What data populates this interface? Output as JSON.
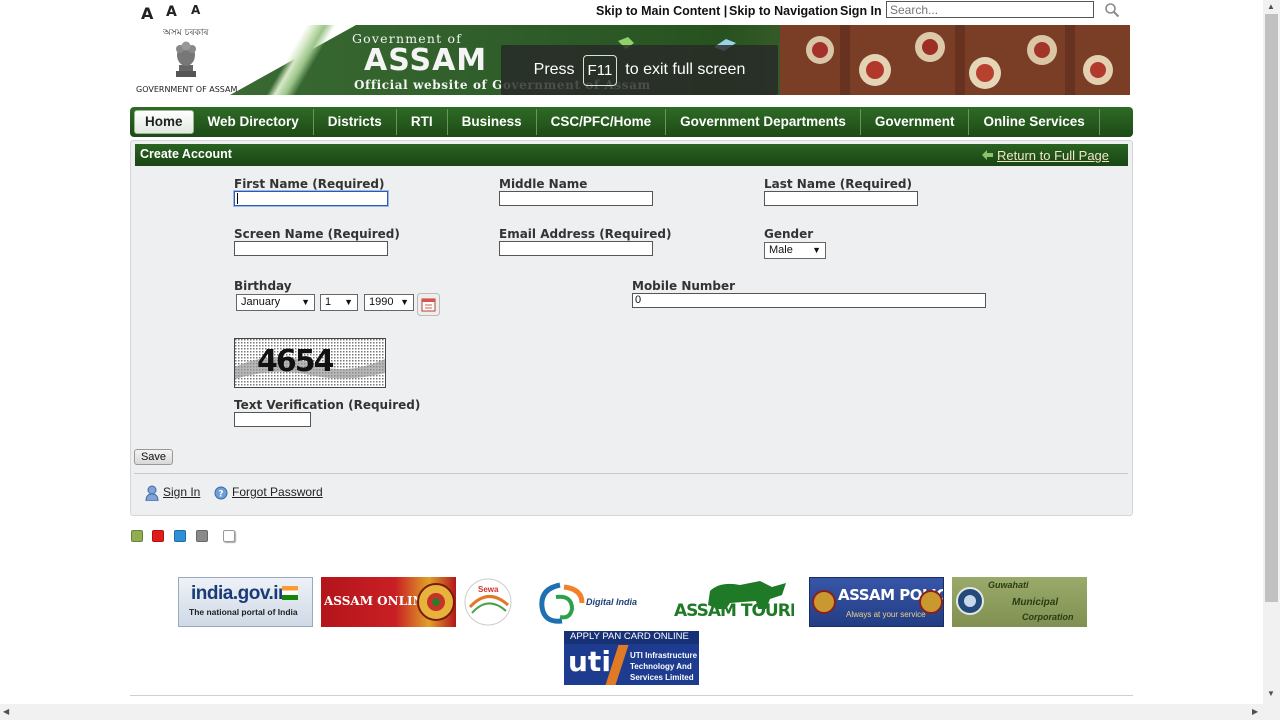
{
  "font_size_controls": [
    "A",
    "A",
    "A"
  ],
  "top_links": {
    "skip_main": "Skip to Main Content |",
    "skip_nav": "Skip to Navigation",
    "sign_in": "Sign In"
  },
  "search": {
    "placeholder": "Search..."
  },
  "banner": {
    "emblem_text": "অসম চৰকাৰ",
    "emblem_caption": "GOVERNMENT OF ASSAM",
    "gov_of": "Government of",
    "state": "ASSAM",
    "official": "Official website of  Government of Assam"
  },
  "fullscreen_notice": {
    "press": "Press",
    "key": "F11",
    "rest": "to exit full screen"
  },
  "nav": {
    "items": [
      "Home",
      "Web Directory",
      "Districts",
      "RTI",
      "Business",
      "CSC/PFC/Home",
      "Government Departments",
      "Government",
      "Online Services"
    ],
    "active": "Home"
  },
  "panel": {
    "title": "Create Account",
    "return_link": "Return to Full Page"
  },
  "form": {
    "first_name_label": "First Name (Required)",
    "first_name_value": "",
    "middle_name_label": "Middle Name",
    "middle_name_value": "",
    "last_name_label": "Last Name (Required)",
    "last_name_value": "",
    "screen_name_label": "Screen Name (Required)",
    "screen_name_value": "",
    "email_label": "Email Address (Required)",
    "email_value": "",
    "gender_label": "Gender",
    "gender_value": "Male",
    "birthday_label": "Birthday",
    "birth_month": "January",
    "birth_day": "1",
    "birth_year": "1990",
    "mobile_label": "Mobile Number",
    "mobile_value": "0",
    "captcha_text": "4654",
    "verification_label": "Text Verification (Required)",
    "verification_value": "",
    "save_label": "Save"
  },
  "bottom_links": {
    "sign_in": "Sign In",
    "forgot_password": "Forgot Password"
  },
  "theme_colors": [
    "#8fae4f",
    "#e21b1b",
    "#2d8fd5",
    "#8a8a8a",
    "#ffffff"
  ],
  "footer_logos": {
    "india_gov": "india.gov.in",
    "india_gov_sub": "The national portal of India",
    "assam_online": "ASSAM ONLINE",
    "sewa": "Sewa",
    "digital_india": "Digital India",
    "assam_tourism": "ASSAM TOURISM",
    "assam_police": "ASSAM POLICE",
    "assam_police_sub": "Always at your service",
    "gmc_1": "Guwahati",
    "gmc_2": "Municipal",
    "gmc_3": "Corporation",
    "pan_card": "APPLY PAN CARD ONLINE",
    "uti": "uti",
    "uti_sub_1": "UTI Infrastructure",
    "uti_sub_2": "Technology And",
    "uti_sub_3": "Services Limited"
  }
}
